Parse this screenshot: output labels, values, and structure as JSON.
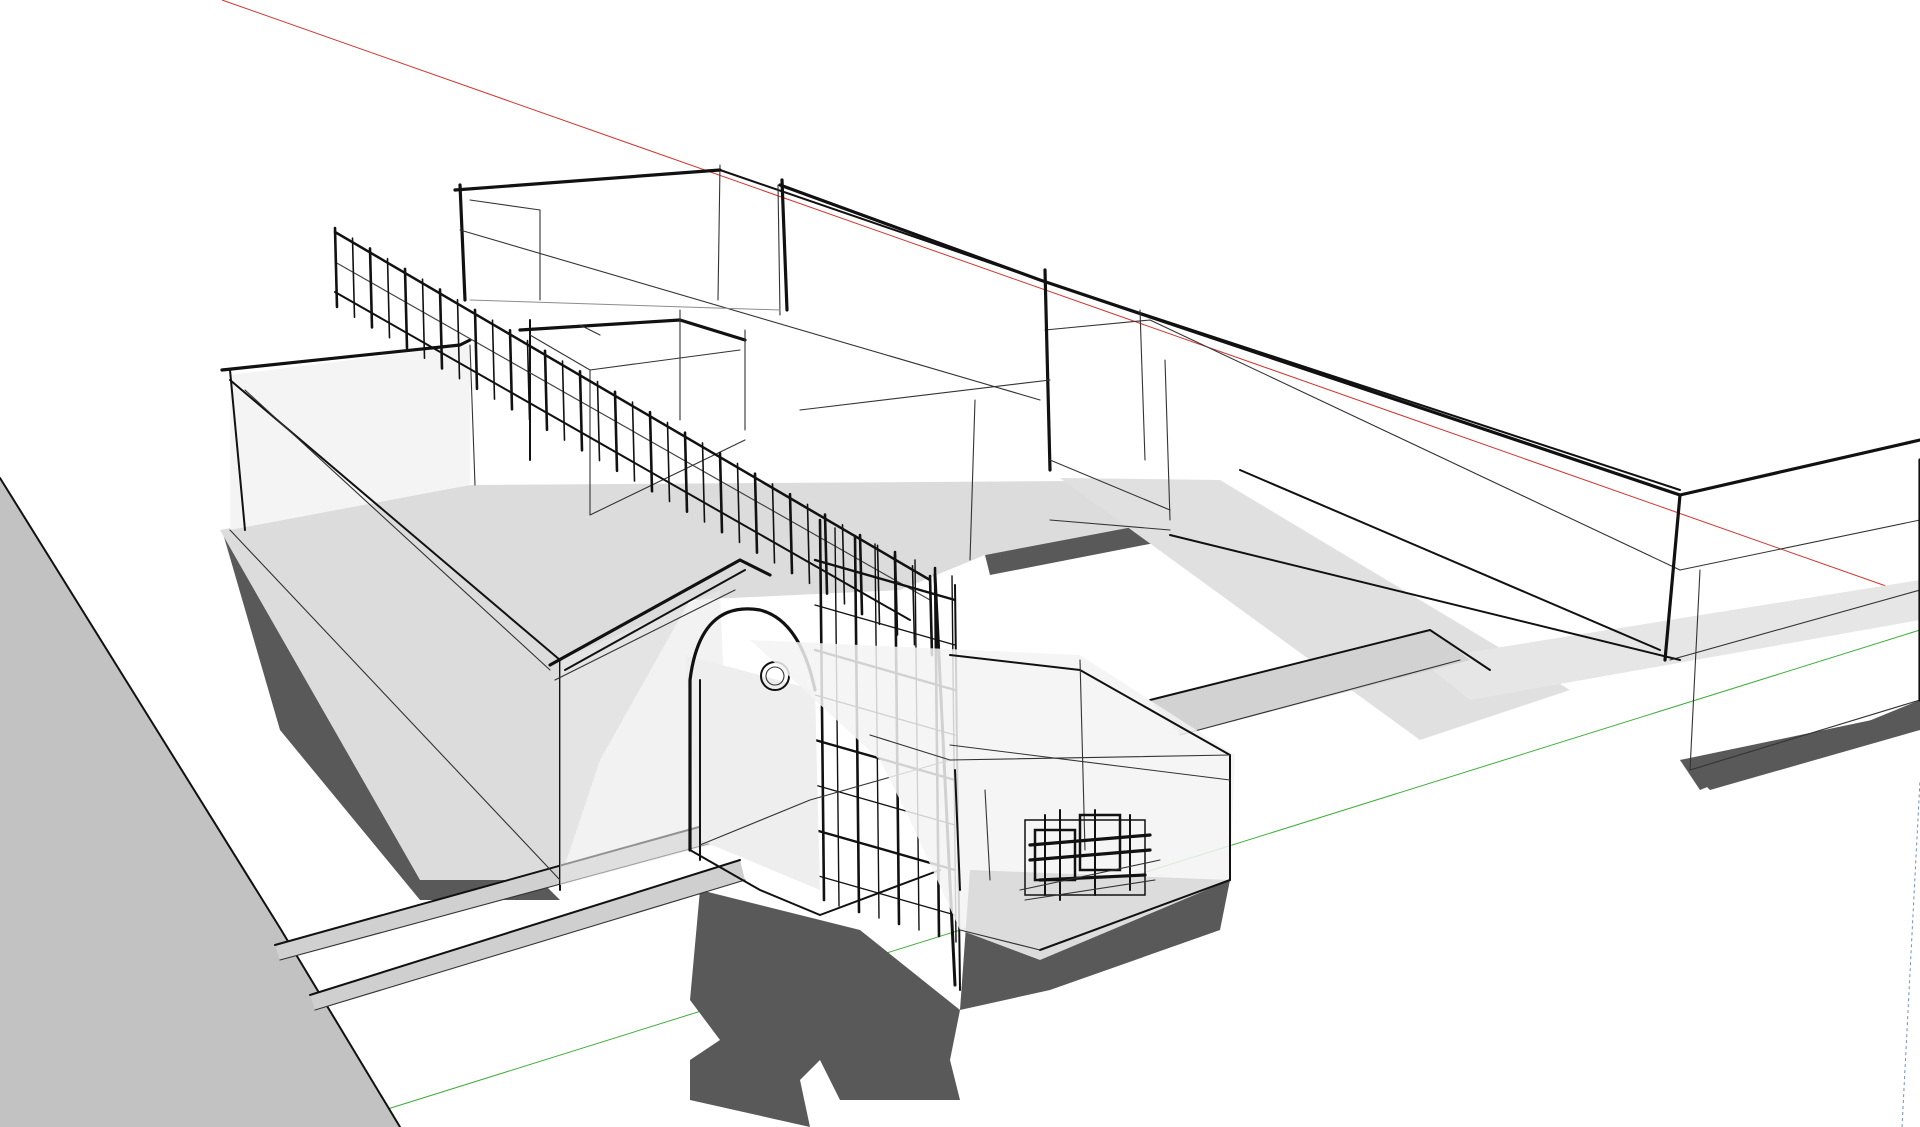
{
  "viewport": {
    "view_style": "sketchy-edges",
    "background": "#ffffff",
    "axes": {
      "red_axis_color": "#d0342c",
      "green_axis_color": "#3fae3a",
      "blue_axis_color": "#6f8fc8"
    },
    "colors": {
      "edge": "#111111",
      "shadow": "#595959",
      "ground_shade": "#cfcfcf",
      "light_face": "#e6e6e6",
      "glass": "#f0f0f0"
    }
  }
}
